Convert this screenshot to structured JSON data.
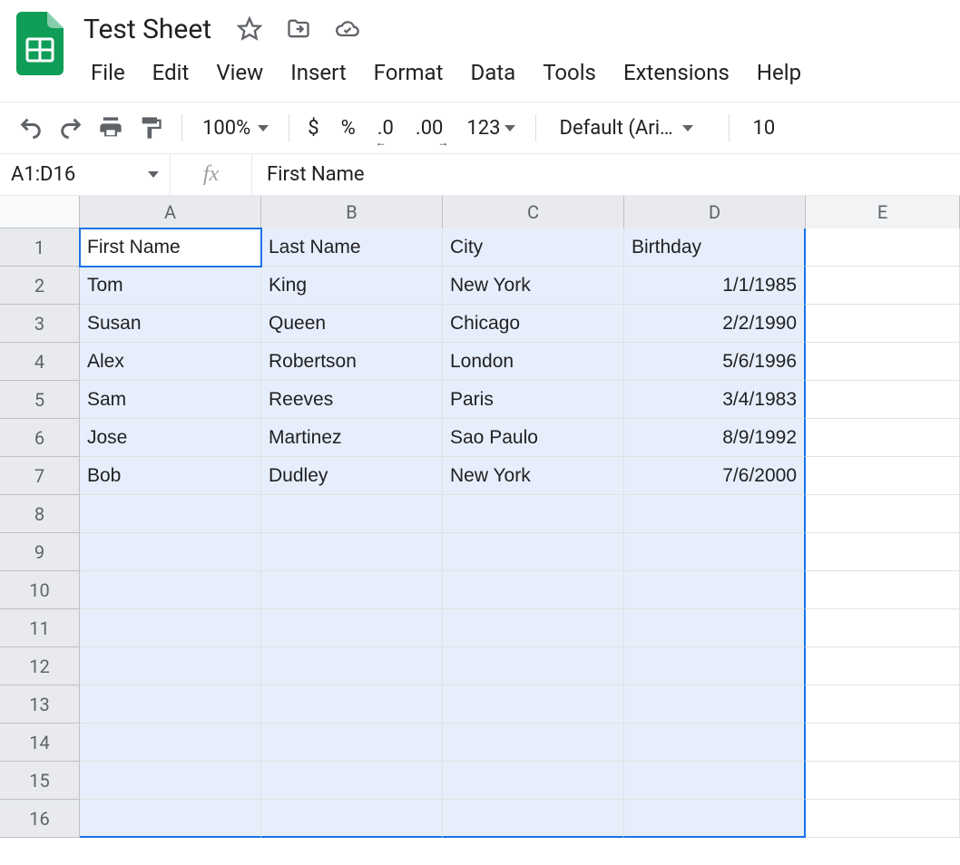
{
  "doc": {
    "title": "Test Sheet"
  },
  "menubar": [
    "File",
    "Edit",
    "View",
    "Insert",
    "Format",
    "Data",
    "Tools",
    "Extensions",
    "Help"
  ],
  "toolbar": {
    "zoom": "100%",
    "currency": "$",
    "percent": "%",
    "dec_decrease": ".0",
    "dec_increase": ".00",
    "more_formats": "123",
    "font": "Default (Ari…",
    "font_size": "10"
  },
  "name_box": "A1:D16",
  "fx_label": "fx",
  "formula_value": "First Name",
  "columns": [
    "A",
    "B",
    "C",
    "D",
    "E"
  ],
  "spreadsheet": {
    "rows_visible": 16,
    "selected_range": "A1:D16",
    "headers": [
      "First Name",
      "Last Name",
      "City",
      "Birthday"
    ],
    "data": [
      {
        "first": "Tom",
        "last": "King",
        "city": "New York",
        "birthday": "1/1/1985"
      },
      {
        "first": "Susan",
        "last": "Queen",
        "city": "Chicago",
        "birthday": "2/2/1990"
      },
      {
        "first": "Alex",
        "last": "Robertson",
        "city": "London",
        "birthday": "5/6/1996"
      },
      {
        "first": "Sam",
        "last": "Reeves",
        "city": "Paris",
        "birthday": "3/4/1983"
      },
      {
        "first": "Jose",
        "last": "Martinez",
        "city": "Sao Paulo",
        "birthday": "8/9/1992"
      },
      {
        "first": "Bob",
        "last": "Dudley",
        "city": "New York",
        "birthday": "7/6/2000"
      }
    ]
  }
}
